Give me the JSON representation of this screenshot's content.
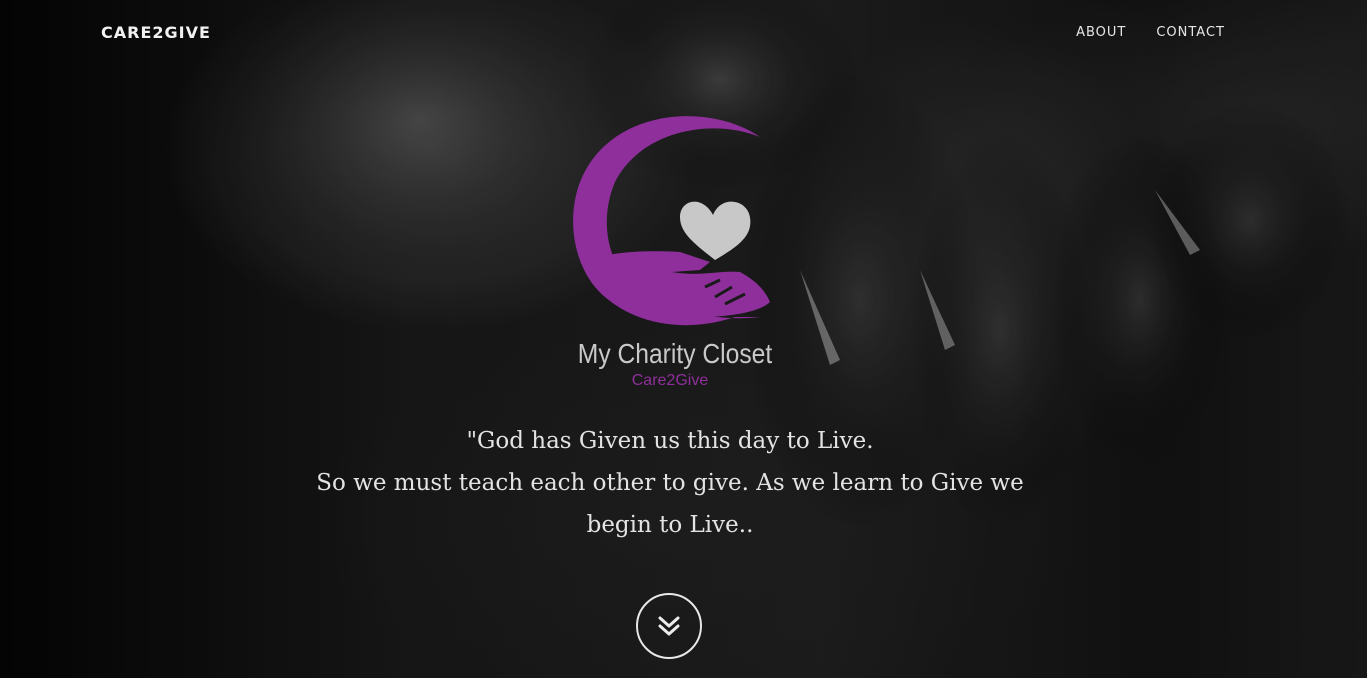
{
  "navbar": {
    "brand": "CARE2GIVE",
    "links": [
      {
        "label": "ABOUT"
      },
      {
        "label": "CONTACT"
      }
    ]
  },
  "hero": {
    "logo": {
      "title": "My Charity Closet",
      "subtitle": "Care2Give",
      "icon": "heart-in-hand-icon",
      "accent_color": "#8e2f9b",
      "heart_color": "#c8c8c8"
    },
    "quote_lines": [
      "\"God has Given us this day to Live.",
      "So we must teach each other to give. As we learn to Give we",
      "begin to Live.."
    ],
    "scroll_icon": "chevron-double-down-icon"
  },
  "colors": {
    "text_light": "#e3e3e3",
    "background": "#0a0a0a"
  }
}
